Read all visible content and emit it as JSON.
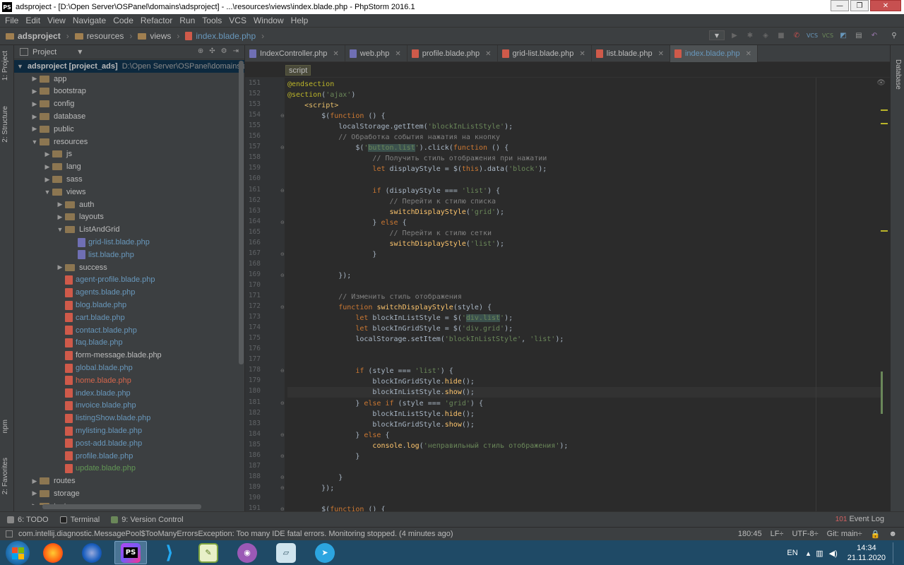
{
  "window": {
    "title": "adsproject - [D:\\Open Server\\OSPanel\\domains\\adsproject] - ...\\resources\\views\\index.blade.php - PhpStorm 2016.1",
    "app_icon": "PS"
  },
  "menu": [
    "File",
    "Edit",
    "View",
    "Navigate",
    "Code",
    "Refactor",
    "Run",
    "Tools",
    "VCS",
    "Window",
    "Help"
  ],
  "breadcrumbs": [
    "adsproject",
    "resources",
    "views",
    "index.blade.php"
  ],
  "left_strip": {
    "project": "1: Project",
    "structure": "2: Structure",
    "npm": "npm",
    "favorites": "2: Favorites"
  },
  "right_strip": {
    "database": "Database"
  },
  "project_panel": {
    "title": "Project",
    "root_name": "adsproject [project_ads]",
    "root_path": "D:\\Open Server\\OSPanel\\domains\\a",
    "tree": [
      {
        "label": "app",
        "depth": 1,
        "type": "folder",
        "arrow": "▶"
      },
      {
        "label": "bootstrap",
        "depth": 1,
        "type": "folder",
        "arrow": "▶"
      },
      {
        "label": "config",
        "depth": 1,
        "type": "folder",
        "arrow": "▶"
      },
      {
        "label": "database",
        "depth": 1,
        "type": "folder",
        "arrow": "▶"
      },
      {
        "label": "public",
        "depth": 1,
        "type": "folder",
        "arrow": "▶"
      },
      {
        "label": "resources",
        "depth": 1,
        "type": "folder",
        "arrow": "▼"
      },
      {
        "label": "js",
        "depth": 2,
        "type": "folder",
        "arrow": "▶"
      },
      {
        "label": "lang",
        "depth": 2,
        "type": "folder",
        "arrow": "▶"
      },
      {
        "label": "sass",
        "depth": 2,
        "type": "folder",
        "arrow": "▶"
      },
      {
        "label": "views",
        "depth": 2,
        "type": "folder",
        "arrow": "▼"
      },
      {
        "label": "auth",
        "depth": 3,
        "type": "folder",
        "arrow": "▶"
      },
      {
        "label": "layouts",
        "depth": 3,
        "type": "folder",
        "arrow": "▶"
      },
      {
        "label": "ListAndGrid",
        "depth": 3,
        "type": "folder",
        "arrow": "▼"
      },
      {
        "label": "grid-list.blade.php",
        "depth": 4,
        "type": "php",
        "color": "blue"
      },
      {
        "label": "list.blade.php",
        "depth": 4,
        "type": "php",
        "color": "blue"
      },
      {
        "label": "success",
        "depth": 3,
        "type": "folder",
        "arrow": "▶"
      },
      {
        "label": "agent-profile.blade.php",
        "depth": 3,
        "type": "blade",
        "color": "blue"
      },
      {
        "label": "agents.blade.php",
        "depth": 3,
        "type": "blade",
        "color": "blue"
      },
      {
        "label": "blog.blade.php",
        "depth": 3,
        "type": "blade",
        "color": "blue"
      },
      {
        "label": "cart.blade.php",
        "depth": 3,
        "type": "blade",
        "color": "blue"
      },
      {
        "label": "contact.blade.php",
        "depth": 3,
        "type": "blade",
        "color": "blue"
      },
      {
        "label": "faq.blade.php",
        "depth": 3,
        "type": "blade",
        "color": "blue"
      },
      {
        "label": "form-message.blade.php",
        "depth": 3,
        "type": "blade",
        "color": "plain"
      },
      {
        "label": "global.blade.php",
        "depth": 3,
        "type": "blade",
        "color": "blue"
      },
      {
        "label": "home.blade.php",
        "depth": 3,
        "type": "blade",
        "color": "red"
      },
      {
        "label": "index.blade.php",
        "depth": 3,
        "type": "blade",
        "color": "blue"
      },
      {
        "label": "invoice.blade.php",
        "depth": 3,
        "type": "blade",
        "color": "blue"
      },
      {
        "label": "listingShow.blade.php",
        "depth": 3,
        "type": "blade",
        "color": "blue"
      },
      {
        "label": "mylisting.blade.php",
        "depth": 3,
        "type": "blade",
        "color": "blue"
      },
      {
        "label": "post-add.blade.php",
        "depth": 3,
        "type": "blade",
        "color": "blue"
      },
      {
        "label": "profile.blade.php",
        "depth": 3,
        "type": "blade",
        "color": "blue"
      },
      {
        "label": "update.blade.php",
        "depth": 3,
        "type": "blade",
        "color": "green"
      },
      {
        "label": "routes",
        "depth": 1,
        "type": "folder",
        "arrow": "▶"
      },
      {
        "label": "storage",
        "depth": 1,
        "type": "folder",
        "arrow": "▶"
      },
      {
        "label": "tests",
        "depth": 1,
        "type": "folder",
        "arrow": "▶"
      }
    ]
  },
  "tabs": [
    {
      "label": "IndexController.php",
      "icon": "php",
      "active": false
    },
    {
      "label": "web.php",
      "icon": "php",
      "active": false
    },
    {
      "label": "profile.blade.php",
      "icon": "blade",
      "active": false
    },
    {
      "label": "grid-list.blade.php",
      "icon": "blade",
      "active": false
    },
    {
      "label": "list.blade.php",
      "icon": "blade",
      "active": false
    },
    {
      "label": "index.blade.php",
      "icon": "blade",
      "active": true
    }
  ],
  "editor_crumb": "script",
  "code": [
    {
      "n": "151",
      "t": [
        [
          "an",
          "@endsection"
        ]
      ]
    },
    {
      "n": "152",
      "t": [
        [
          "an",
          "@section"
        ],
        [
          "pl",
          "("
        ],
        [
          "str",
          "'ajax'"
        ],
        [
          "pl",
          ")"
        ]
      ]
    },
    {
      "n": "153",
      "t": [
        [
          "pl",
          "    "
        ],
        [
          "tg",
          "<script>"
        ]
      ]
    },
    {
      "n": "154",
      "t": [
        [
          "pl",
          "        $("
        ],
        [
          "kw",
          "function"
        ],
        [
          "pl",
          " () {"
        ]
      ]
    },
    {
      "n": "155",
      "t": [
        [
          "pl",
          "            localStorage.getItem("
        ],
        [
          "str",
          "'blockInListStyle'"
        ],
        [
          "pl",
          ");"
        ]
      ]
    },
    {
      "n": "156",
      "t": [
        [
          "cm",
          "            // Обработка события нажатия на кнопку"
        ]
      ]
    },
    {
      "n": "157",
      "t": [
        [
          "pl",
          "                $("
        ],
        [
          "str",
          "'"
        ],
        [
          "hlstr",
          "button.list"
        ],
        [
          "str",
          "'"
        ],
        [
          "pl",
          ").click("
        ],
        [
          "kw",
          "function"
        ],
        [
          "pl",
          " () {"
        ]
      ]
    },
    {
      "n": "158",
      "t": [
        [
          "cm",
          "                    // Получить стиль отображения при нажатии"
        ]
      ]
    },
    {
      "n": "159",
      "t": [
        [
          "pl",
          "                    "
        ],
        [
          "kw",
          "let"
        ],
        [
          "pl",
          " displayStyle = $("
        ],
        [
          "kw",
          "this"
        ],
        [
          "pl",
          ").data("
        ],
        [
          "str",
          "'block'"
        ],
        [
          "pl",
          ");"
        ]
      ]
    },
    {
      "n": "160",
      "t": [
        [
          "pl",
          ""
        ]
      ]
    },
    {
      "n": "161",
      "t": [
        [
          "pl",
          "                    "
        ],
        [
          "kw",
          "if"
        ],
        [
          "pl",
          " (displayStyle === "
        ],
        [
          "str",
          "'list'"
        ],
        [
          "pl",
          ") {"
        ]
      ]
    },
    {
      "n": "162",
      "t": [
        [
          "cm",
          "                        // Перейти к стилю списка"
        ]
      ]
    },
    {
      "n": "163",
      "t": [
        [
          "pl",
          "                        "
        ],
        [
          "fn",
          "switchDisplayStyle"
        ],
        [
          "pl",
          "("
        ],
        [
          "str",
          "'grid'"
        ],
        [
          "pl",
          ");"
        ]
      ]
    },
    {
      "n": "164",
      "t": [
        [
          "pl",
          "                    } "
        ],
        [
          "kw",
          "else"
        ],
        [
          "pl",
          " {"
        ]
      ]
    },
    {
      "n": "165",
      "t": [
        [
          "cm",
          "                        // Перейти к стилю сетки"
        ]
      ]
    },
    {
      "n": "166",
      "t": [
        [
          "pl",
          "                        "
        ],
        [
          "fn",
          "switchDisplayStyle"
        ],
        [
          "pl",
          "("
        ],
        [
          "str",
          "'list'"
        ],
        [
          "pl",
          ");"
        ]
      ]
    },
    {
      "n": "167",
      "t": [
        [
          "pl",
          "                    }"
        ]
      ]
    },
    {
      "n": "168",
      "t": [
        [
          "pl",
          ""
        ]
      ]
    },
    {
      "n": "169",
      "t": [
        [
          "pl",
          "            });"
        ]
      ]
    },
    {
      "n": "170",
      "t": [
        [
          "pl",
          ""
        ]
      ]
    },
    {
      "n": "171",
      "t": [
        [
          "cm",
          "            // Изменить стиль отображения"
        ]
      ]
    },
    {
      "n": "172",
      "t": [
        [
          "pl",
          "            "
        ],
        [
          "kw",
          "function"
        ],
        [
          "pl",
          " "
        ],
        [
          "fn",
          "switchDisplayStyle"
        ],
        [
          "pl",
          "(style) {"
        ]
      ]
    },
    {
      "n": "173",
      "t": [
        [
          "pl",
          "                "
        ],
        [
          "kw",
          "let"
        ],
        [
          "pl",
          " blockInListStyle = $("
        ],
        [
          "str",
          "'"
        ],
        [
          "hlstr",
          "div.list"
        ],
        [
          "str",
          "'"
        ],
        [
          "pl",
          ");"
        ]
      ]
    },
    {
      "n": "174",
      "t": [
        [
          "pl",
          "                "
        ],
        [
          "kw",
          "let"
        ],
        [
          "pl",
          " blockInGridStyle = $("
        ],
        [
          "str",
          "'div.grid'"
        ],
        [
          "pl",
          ");"
        ]
      ]
    },
    {
      "n": "175",
      "t": [
        [
          "pl",
          "                localStorage.setItem("
        ],
        [
          "str",
          "'blockInListStyle'"
        ],
        [
          "pl",
          ", "
        ],
        [
          "str",
          "'list'"
        ],
        [
          "pl",
          ");"
        ]
      ]
    },
    {
      "n": "176",
      "t": [
        [
          "pl",
          ""
        ]
      ]
    },
    {
      "n": "177",
      "t": [
        [
          "pl",
          ""
        ]
      ]
    },
    {
      "n": "178",
      "t": [
        [
          "pl",
          "                "
        ],
        [
          "kw",
          "if"
        ],
        [
          "pl",
          " (style === "
        ],
        [
          "str",
          "'list'"
        ],
        [
          "pl",
          ") {"
        ]
      ]
    },
    {
      "n": "179",
      "t": [
        [
          "pl",
          "                    blockInGridStyle."
        ],
        [
          "fn",
          "hide"
        ],
        [
          "pl",
          "();"
        ]
      ]
    },
    {
      "n": "180",
      "t": [
        [
          "pl",
          "                    blockInListStyle."
        ],
        [
          "fn",
          "show"
        ],
        [
          "pl",
          "();"
        ]
      ],
      "cur": true
    },
    {
      "n": "181",
      "t": [
        [
          "pl",
          "                } "
        ],
        [
          "kw",
          "else if"
        ],
        [
          "pl",
          " (style === "
        ],
        [
          "str",
          "'grid'"
        ],
        [
          "pl",
          ") {"
        ]
      ]
    },
    {
      "n": "182",
      "t": [
        [
          "pl",
          "                    blockInListStyle."
        ],
        [
          "fn",
          "hide"
        ],
        [
          "pl",
          "();"
        ]
      ]
    },
    {
      "n": "183",
      "t": [
        [
          "pl",
          "                    blockInGridStyle."
        ],
        [
          "fn",
          "show"
        ],
        [
          "pl",
          "();"
        ]
      ]
    },
    {
      "n": "184",
      "t": [
        [
          "pl",
          "                } "
        ],
        [
          "kw",
          "else"
        ],
        [
          "pl",
          " {"
        ]
      ]
    },
    {
      "n": "185",
      "t": [
        [
          "pl",
          "                    "
        ],
        [
          "fn",
          "console"
        ],
        [
          "pl",
          "."
        ],
        [
          "fn",
          "log"
        ],
        [
          "pl",
          "("
        ],
        [
          "str",
          "'неправильный стиль отображения'"
        ],
        [
          "pl",
          ");"
        ]
      ]
    },
    {
      "n": "186",
      "t": [
        [
          "pl",
          "                }"
        ]
      ]
    },
    {
      "n": "187",
      "t": [
        [
          "pl",
          ""
        ]
      ]
    },
    {
      "n": "188",
      "t": [
        [
          "pl",
          "            }"
        ]
      ]
    },
    {
      "n": "189",
      "t": [
        [
          "pl",
          "        });"
        ]
      ]
    },
    {
      "n": "190",
      "t": [
        [
          "pl",
          ""
        ]
      ]
    },
    {
      "n": "191",
      "t": [
        [
          "pl",
          "        $("
        ],
        [
          "kw",
          "function"
        ],
        [
          "pl",
          " () {"
        ]
      ]
    }
  ],
  "bottom_tabs": [
    {
      "label": "6: TODO"
    },
    {
      "label": "Terminal"
    },
    {
      "label": "9: Version Control"
    }
  ],
  "event_log": {
    "count": "101",
    "label": "Event Log"
  },
  "status": {
    "message": "com.intellij.diagnostic.MessagePool$TooManyErrorsException: Too many IDE fatal errors. Monitoring stopped. (4 minutes ago)",
    "position": "180:45",
    "line_sep": "LF÷",
    "encoding": "UTF-8÷",
    "git": "Git: main÷"
  },
  "taskbar": {
    "apps": [
      "windows-start",
      "firefox",
      "firefox-dev",
      "phpstorm",
      "vscode",
      "notepad-plus",
      "app-purple",
      "app-notes",
      "telegram"
    ],
    "lang": "EN",
    "time": "14:34",
    "date": "21.11.2020"
  },
  "colors": {
    "accent": "#6897bb",
    "keyword": "#cc7832",
    "string": "#6a8759",
    "comment": "#808080",
    "function": "#ffc66d",
    "taskbar": "#1f4a66"
  }
}
